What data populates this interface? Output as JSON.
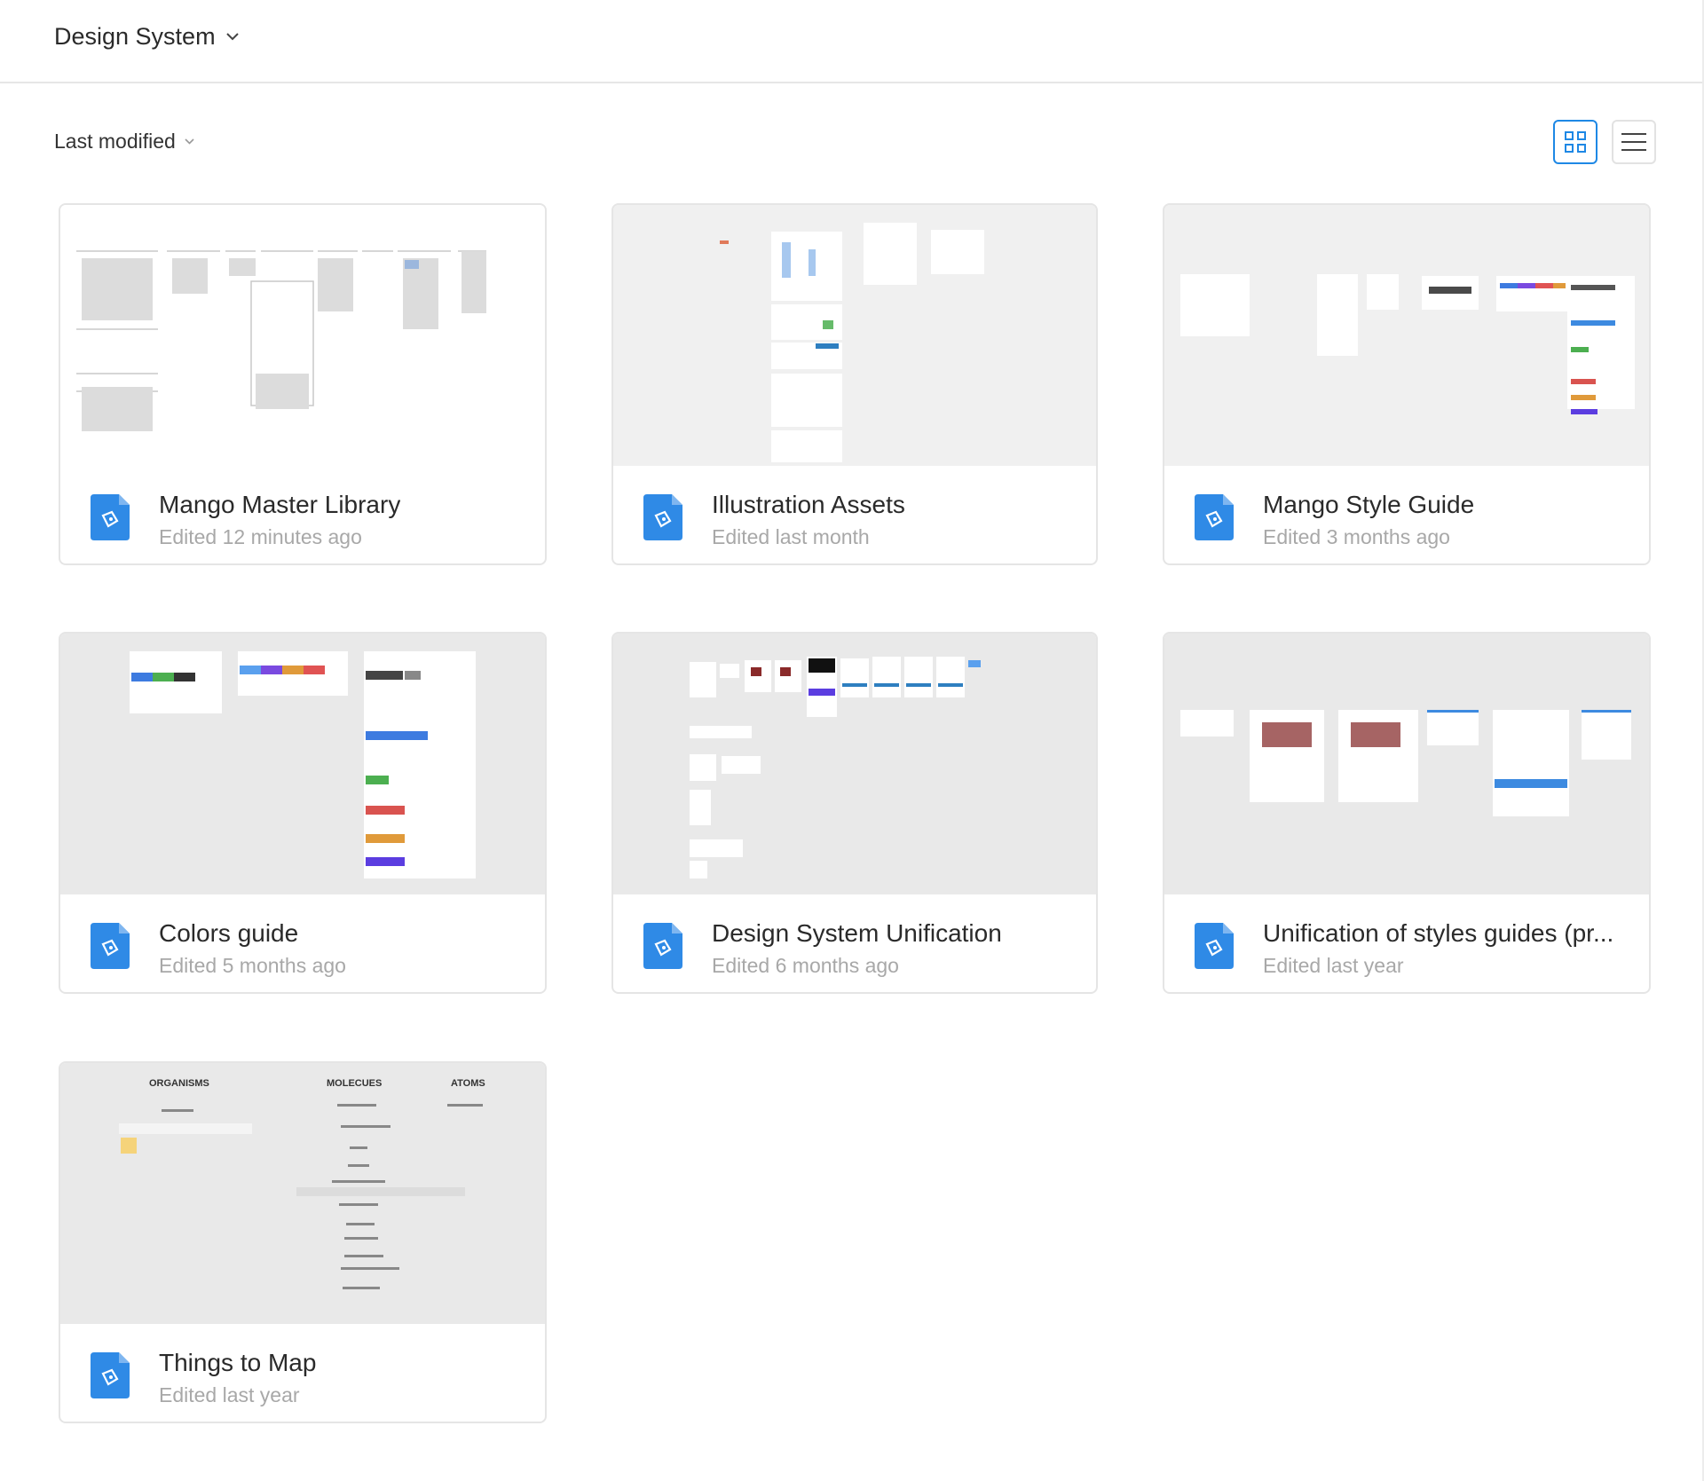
{
  "header": {
    "project_title": "Design System"
  },
  "toolbar": {
    "sort_label": "Last modified"
  },
  "files": [
    {
      "title": "Mango Master Library",
      "subtitle": "Edited 12 minutes ago"
    },
    {
      "title": "Illustration Assets",
      "subtitle": "Edited last month"
    },
    {
      "title": "Mango Style Guide",
      "subtitle": "Edited 3 months ago"
    },
    {
      "title": "Colors guide",
      "subtitle": "Edited 5 months ago"
    },
    {
      "title": "Design System Unification",
      "subtitle": "Edited 6 months ago"
    },
    {
      "title": "Unification of styles guides (pr...",
      "subtitle": "Edited last year"
    },
    {
      "title": "Things to Map",
      "subtitle": "Edited last year"
    }
  ],
  "thumb_text": {
    "organisms": "ORGANISMS",
    "molecules": "MOLECUES",
    "atoms": "ATOMS"
  },
  "colors": {
    "accent": "#1e88e5",
    "file_icon": "#2f8ae6"
  }
}
